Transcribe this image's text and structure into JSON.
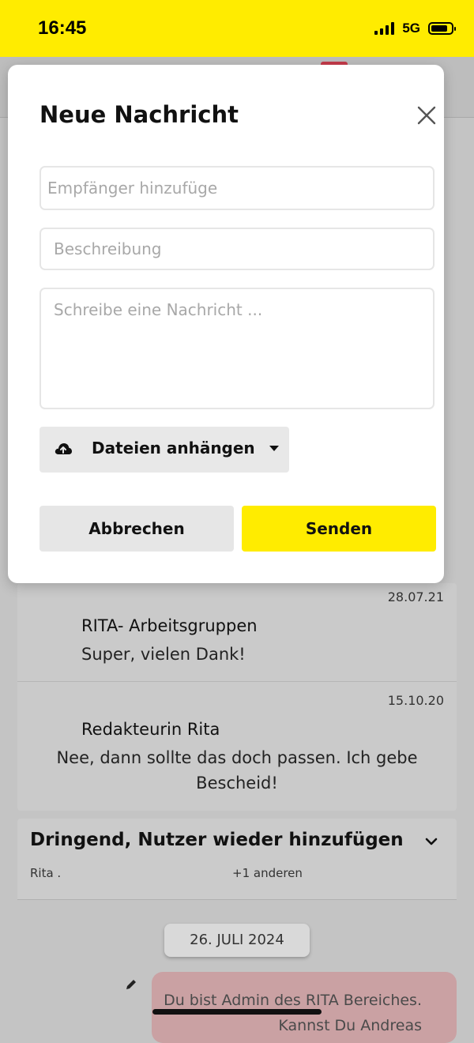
{
  "status_bar": {
    "time": "16:45",
    "network": "5G"
  },
  "modal": {
    "title": "Neue Nachricht",
    "recipient_placeholder": "Empfänger hinzufüge",
    "description_placeholder": "Beschreibung",
    "message_placeholder": "Schreibe eine Nachricht ...",
    "attach_label": "Dateien anhängen",
    "cancel_label": "Abbrechen",
    "send_label": "Senden"
  },
  "messages": [
    {
      "date": "28.07.21",
      "sender": "RITA- Arbeitsgruppen",
      "text": "Super, vielen Dank!"
    },
    {
      "date": "15.10.20",
      "sender": "Redakteurin Rita",
      "text": "Nee, dann sollte das doch passen. Ich gebe Bescheid!"
    }
  ],
  "thread": {
    "title": "Dringend, Nutzer wieder hinzufügen",
    "participant": "Rita .",
    "others": "+1 anderen",
    "date_separator": "26. JULI 2024",
    "bubble_text": "Du bist Admin des RITA Bereiches. Kannst Du Andreas"
  },
  "colors": {
    "brand_yellow": "#ffec00",
    "bubble": "#caa1a3"
  },
  "icons": [
    "close-icon",
    "cloud-upload-icon",
    "caret-down-icon",
    "chevron-down-icon",
    "pencil-icon"
  ]
}
